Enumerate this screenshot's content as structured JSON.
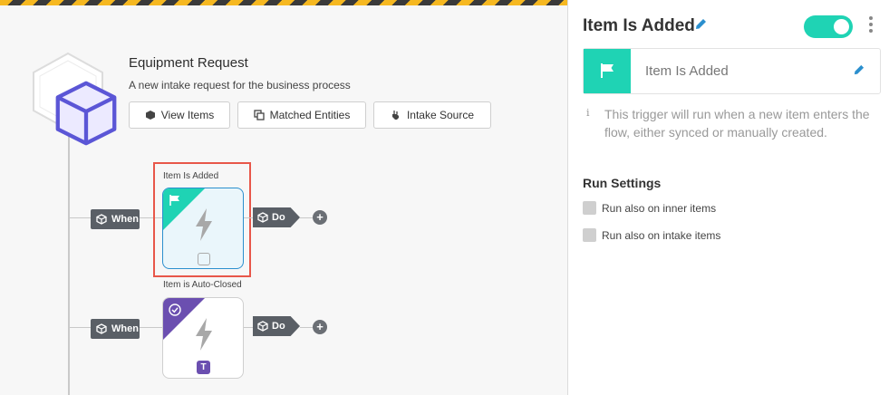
{
  "process": {
    "title": "Equipment Request",
    "description": "A new intake request for the business process",
    "buttons": {
      "view_items": "View Items",
      "matched_entities": "Matched Entities",
      "intake_source": "Intake Source"
    }
  },
  "flow": {
    "nodes": [
      {
        "label": "Item Is Added",
        "when": "When",
        "do": "Do",
        "plus": "+",
        "icon": "flag-icon",
        "selected": true
      },
      {
        "label": "Item is Auto-Closed",
        "when": "When",
        "do": "Do",
        "plus": "+",
        "icon": "check-circle-icon",
        "badge": "T"
      }
    ]
  },
  "panel": {
    "title": "Item Is Added",
    "toggle_on": true,
    "trigger_name": "Item Is Added",
    "info_icon": "i",
    "info_text": "This trigger will run when a new item enters the flow, either synced or manually created.",
    "run_settings": {
      "title": "Run Settings",
      "options": [
        {
          "label": "Run also on inner items",
          "checked": false
        },
        {
          "label": "Run also on intake items",
          "checked": false
        }
      ]
    }
  },
  "colors": {
    "accent_teal": "#1fd3b4",
    "accent_purple": "#6b4fb0",
    "selection_red": "#e8574a",
    "edit_blue": "#2b8fce"
  }
}
